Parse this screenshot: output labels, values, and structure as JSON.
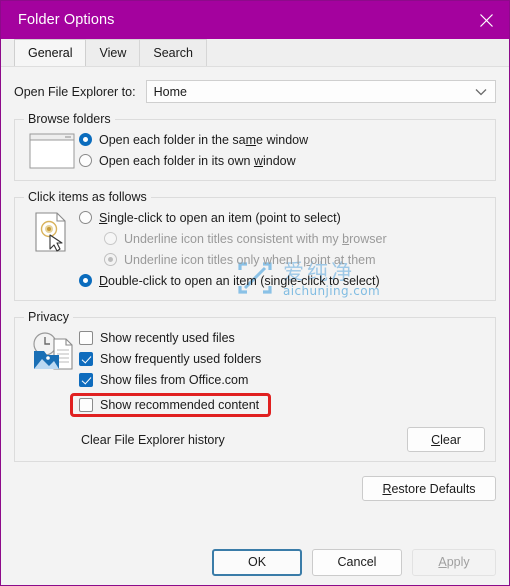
{
  "window": {
    "title": "Folder Options",
    "title_bar_color": "#a4029e",
    "close_icon": "close-icon"
  },
  "tabs": [
    {
      "label": "General",
      "active": true
    },
    {
      "label": "View",
      "active": false
    },
    {
      "label": "Search",
      "active": false
    }
  ],
  "general": {
    "open_explorer_label": "Open File Explorer to:",
    "open_explorer_value": "Home",
    "open_explorer_chevron": "chevron-down-icon",
    "browse_folders": {
      "legend": "Browse folders",
      "icon": "window-icon",
      "options": [
        {
          "label_pre": "Open each folder in the sa",
          "accel": "m",
          "label_post": "e window",
          "selected": true
        },
        {
          "label_pre": "Open each folder in its own ",
          "accel": "w",
          "label_post": "indow",
          "selected": false
        }
      ]
    },
    "click_items": {
      "legend": "Click items as follows",
      "icon": "document-pointer-icon",
      "options": [
        {
          "label_pre": "",
          "accel": "S",
          "label_post": "ingle-click to open an item (point to select)",
          "selected": false,
          "disabled": false,
          "indent": false
        },
        {
          "label_pre": "Underline icon titles consistent with my ",
          "accel": "b",
          "label_post": "rowser",
          "selected": false,
          "disabled": true,
          "indent": true
        },
        {
          "label_pre": "Underline icon titles only when I ",
          "accel": "p",
          "label_post": "oint at them",
          "selected": true,
          "disabled": true,
          "indent": true
        },
        {
          "label_pre": "",
          "accel": "D",
          "label_post": "ouble-click to open an item (single-click to select)",
          "selected": true,
          "disabled": false,
          "indent": false
        }
      ]
    },
    "privacy": {
      "legend": "Privacy",
      "icon": "recent-files-icon",
      "checkboxes": [
        {
          "label": "Show recently used files",
          "checked": false,
          "highlighted": false
        },
        {
          "label": "Show frequently used folders",
          "checked": true,
          "highlighted": false
        },
        {
          "label": "Show files from Office.com",
          "checked": true,
          "highlighted": false
        },
        {
          "label": "Show recommended content",
          "checked": false,
          "highlighted": true
        }
      ],
      "highlight_color": "#e02020",
      "clear_history_label": "Clear File Explorer history",
      "clear_button": "Clear",
      "clear_button_accel": "C"
    },
    "restore_defaults": {
      "label_pre": "",
      "accel": "R",
      "label_post": "estore Defaults"
    }
  },
  "footer": {
    "ok": "OK",
    "cancel": "Cancel",
    "apply_pre": "",
    "apply_accel": "A",
    "apply_post": "pply",
    "apply_disabled": true
  },
  "watermark": {
    "cn_text": "爱纯净",
    "site": "aichunjing.com",
    "logo": "aichunjing-logo-icon",
    "color": "#3a9bd8"
  }
}
